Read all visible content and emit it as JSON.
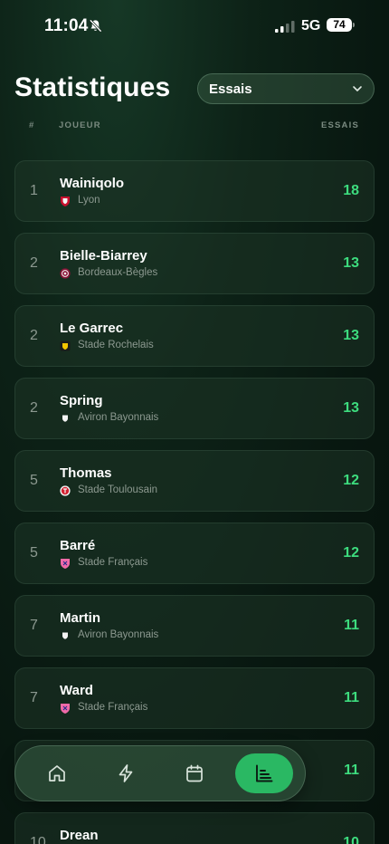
{
  "status_bar": {
    "time": "11:04",
    "network": "5G",
    "battery": "74"
  },
  "header": {
    "title": "Statistiques",
    "dropdown_value": "Essais"
  },
  "columns": {
    "rank": "#",
    "player": "JOUEUR",
    "value": "ESSAIS"
  },
  "rows": [
    {
      "rank": "1",
      "name": "Wainiqolo",
      "team": "Lyon",
      "value": "18",
      "team_color": "#c8102e"
    },
    {
      "rank": "2",
      "name": "Bielle-Biarrey",
      "team": "Bordeaux-Bègles",
      "value": "13",
      "team_color": "#8a1538"
    },
    {
      "rank": "2",
      "name": "Le Garrec",
      "team": "Stade Rochelais",
      "value": "13",
      "team_color": "#f2c400"
    },
    {
      "rank": "2",
      "name": "Spring",
      "team": "Aviron Bayonnais",
      "value": "13",
      "team_color": "#ffffff"
    },
    {
      "rank": "5",
      "name": "Thomas",
      "team": "Stade Toulousain",
      "value": "12",
      "team_color": "#d22030"
    },
    {
      "rank": "5",
      "name": "Barré",
      "team": "Stade Français",
      "value": "12",
      "team_color": "#f06aa8"
    },
    {
      "rank": "7",
      "name": "Martin",
      "team": "Aviron Bayonnais",
      "value": "11",
      "team_color": "#ffffff"
    },
    {
      "rank": "7",
      "name": "Ward",
      "team": "Stade Français",
      "value": "11",
      "team_color": "#f06aa8"
    },
    {
      "rank": "",
      "name": "",
      "team": "",
      "value": "11",
      "team_color": "#ffffff"
    },
    {
      "rank": "10",
      "name": "Drean",
      "team": "",
      "value": "10",
      "team_color": "#ffffff"
    }
  ],
  "tabbar": {
    "tabs": [
      {
        "icon": "home-icon"
      },
      {
        "icon": "lightning-icon"
      },
      {
        "icon": "calendar-icon"
      },
      {
        "icon": "stats-chart-icon",
        "active": true
      }
    ]
  },
  "colors": {
    "accent": "#2ab863",
    "value_green": "#3ddc7e",
    "background": "#0b1c13"
  }
}
